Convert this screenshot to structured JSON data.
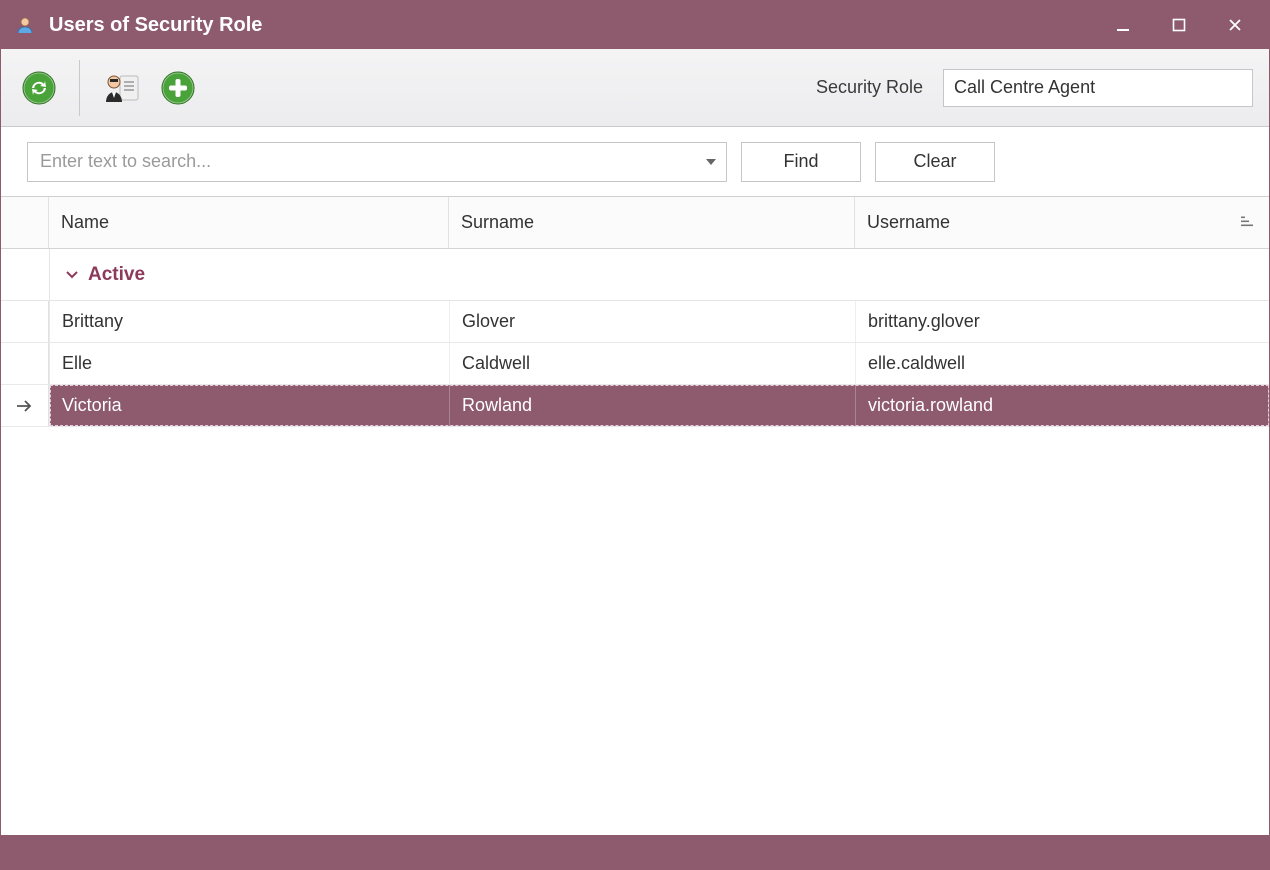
{
  "window": {
    "title": "Users of Security Role"
  },
  "toolbar": {
    "role_label": "Security Role",
    "role_value": "Call Centre Agent"
  },
  "search": {
    "placeholder": "Enter text to search...",
    "value": "",
    "find_label": "Find",
    "clear_label": "Clear"
  },
  "grid": {
    "columns": {
      "name": "Name",
      "surname": "Surname",
      "username": "Username"
    },
    "group_label": "Active",
    "rows": [
      {
        "name": "Brittany",
        "surname": "Glover",
        "username": "brittany.glover",
        "selected": false
      },
      {
        "name": "Elle",
        "surname": "Caldwell",
        "username": "elle.caldwell",
        "selected": false
      },
      {
        "name": "Victoria",
        "surname": "Rowland",
        "username": "victoria.rowland",
        "selected": true
      }
    ]
  }
}
